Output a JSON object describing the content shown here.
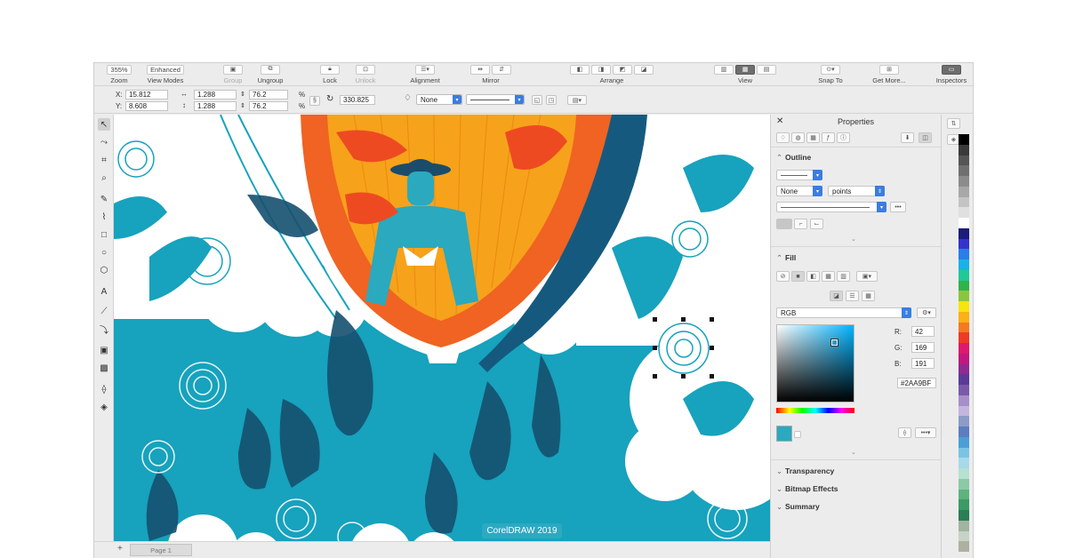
{
  "toolbar": {
    "zoom": {
      "value": "355%",
      "label": "Zoom"
    },
    "view_modes": {
      "value": "Enhanced",
      "label": "View Modes"
    },
    "group": {
      "label": "Group"
    },
    "ungroup": {
      "label": "Ungroup"
    },
    "lock": {
      "label": "Lock"
    },
    "unlock": {
      "label": "Unlock"
    },
    "alignment": {
      "label": "Alignment"
    },
    "mirror": {
      "label": "Mirror"
    },
    "arrange": {
      "label": "Arrange"
    },
    "view": {
      "label": "View"
    },
    "snap_to": {
      "label": "Snap To"
    },
    "get_more": {
      "label": "Get More..."
    },
    "inspectors": {
      "label": "Inspectors"
    }
  },
  "propbar": {
    "x_label": "X:",
    "x_value": "15.812",
    "y_label": "Y:",
    "y_value": "8.608",
    "w_value": "1.288",
    "h_value": "1.288",
    "sx_value": "76.2",
    "sy_value": "76.2",
    "pct": "%",
    "angle_value": "330.825",
    "outline_style": "None"
  },
  "status": {
    "page_tab": "Page 1"
  },
  "badge": "CorelDRAW 2019",
  "panel": {
    "title": "Properties",
    "outline": {
      "title": "Outline",
      "width_style": "None",
      "units": "points"
    },
    "fill": {
      "title": "Fill",
      "color_model": "RGB",
      "r_label": "R:",
      "r": "42",
      "g_label": "G:",
      "g": "169",
      "b_label": "B:",
      "b": "191",
      "hex": "#2AA9BF",
      "swatch_color": "#2AA9BF"
    },
    "sections": {
      "transparency": "Transparency",
      "bitmap_effects": "Bitmap Effects",
      "summary": "Summary"
    }
  },
  "palette_colors": [
    "#000000",
    "#3a3a3a",
    "#555555",
    "#707070",
    "#8c8c8c",
    "#a8a8a8",
    "#c4c4c4",
    "#e0e0e0",
    "#ffffff",
    "#1c1c7a",
    "#3333cc",
    "#2b7de9",
    "#18b3e6",
    "#20c997",
    "#2fb34a",
    "#8bc53f",
    "#f5e50a",
    "#fbb015",
    "#f47a20",
    "#ee3a24",
    "#e0186c",
    "#c0187f",
    "#8d2b8f",
    "#5b3a98",
    "#7a5aa8",
    "#a68fc9",
    "#c4b5dd",
    "#8c9bc8",
    "#5c7dc0",
    "#4b9fd7",
    "#7ac4e3",
    "#a7d9ea",
    "#b7e1d0",
    "#8cc9a6",
    "#5db37d",
    "#3c9a66",
    "#2b7d55",
    "#9fb5a0",
    "#c7d3c5",
    "#b0b0a0"
  ]
}
